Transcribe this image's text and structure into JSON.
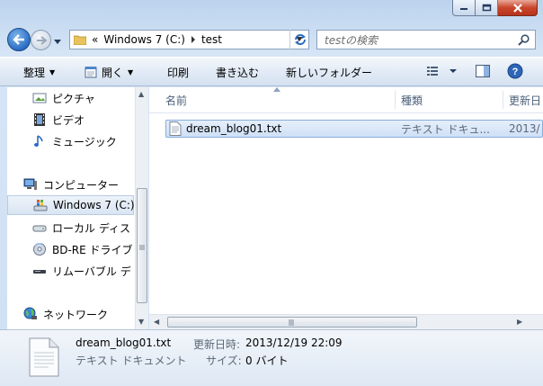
{
  "window": {
    "caption_buttons": {
      "minimize": "minimize-icon",
      "maximize": "maximize-icon",
      "close": "close-icon"
    }
  },
  "nav": {
    "address_chevron": "«",
    "breadcrumbs": [
      "Windows 7 (C:)",
      "test"
    ],
    "search_placeholder": "testの検索"
  },
  "toolbar": {
    "organize": "整理",
    "open": "開く",
    "print": "印刷",
    "burn": "書き込む",
    "new_folder": "新しいフォルダー"
  },
  "sidebar": {
    "items": [
      {
        "label": "ピクチャ",
        "icon": "pictures-icon"
      },
      {
        "label": "ビデオ",
        "icon": "video-icon"
      },
      {
        "label": "ミュージック",
        "icon": "music-icon"
      },
      {
        "label": "コンピューター",
        "icon": "computer-icon"
      },
      {
        "label": "Windows 7 (C:)",
        "icon": "system-drive-icon"
      },
      {
        "label": "ローカル ディス",
        "icon": "local-disk-icon"
      },
      {
        "label": "BD-RE ドライブ",
        "icon": "bd-drive-icon"
      },
      {
        "label": "リムーバブル デ",
        "icon": "removable-disk-icon"
      },
      {
        "label": "ネットワーク",
        "icon": "network-icon"
      }
    ]
  },
  "file_list": {
    "columns": [
      "名前",
      "種類",
      "更新日"
    ],
    "rows": [
      {
        "name": "dream_blog01.txt",
        "type": "テキスト ドキュ...",
        "date": "2013/"
      }
    ]
  },
  "details": {
    "file_name": "dream_blog01.txt",
    "modified_label": "更新日時:",
    "modified_value": "2013/12/19 22:09",
    "type_value": "テキスト ドキュメント",
    "size_label": "サイズ:",
    "size_value": "0 バイト"
  },
  "colors": {
    "accent": "#2a6fc4",
    "selection": "#cfe0f6",
    "close": "#c9462c"
  }
}
